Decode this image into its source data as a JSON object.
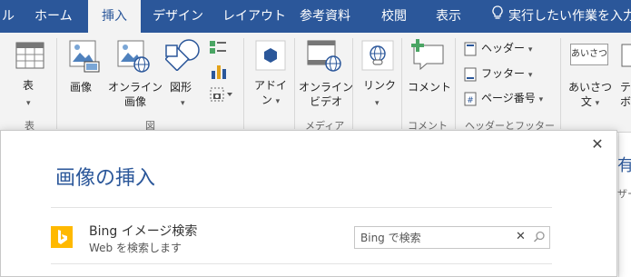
{
  "tabs": [
    {
      "label": "ル",
      "active": false
    },
    {
      "label": "ホーム",
      "active": false
    },
    {
      "label": "挿入",
      "active": true
    },
    {
      "label": "デザイン",
      "active": false
    },
    {
      "label": "レイアウト",
      "active": false
    },
    {
      "label": "参考資料",
      "active": false
    },
    {
      "label": "校閲",
      "active": false
    },
    {
      "label": "表示",
      "active": false
    }
  ],
  "tellme": {
    "label": "実行したい作業を入力"
  },
  "ribbon": {
    "table": {
      "label": "表",
      "group": "表"
    },
    "picture": {
      "label": "画像"
    },
    "online_picture": {
      "line1": "オンライン",
      "line2": "画像"
    },
    "shapes": {
      "label": "図形"
    },
    "illustrations_group": "図",
    "addins": {
      "line1": "アドイ",
      "line2": "ン"
    },
    "online_video": {
      "line1": "オンライン",
      "line2": "ビデオ"
    },
    "media_group": "メディア",
    "link": {
      "label": "リンク"
    },
    "comment": {
      "label": "コメント",
      "group": "コメント"
    },
    "header": {
      "label": "ヘッダー"
    },
    "footer": {
      "label": "フッター"
    },
    "page_number": {
      "label": "ページ番号"
    },
    "header_footer_group": "ヘッダーとフッター",
    "greeting": {
      "badge": "あいさつ",
      "line1": "あいさつ",
      "line2": "文"
    },
    "textbox": {
      "line1": "テ",
      "line2": "ボ"
    }
  },
  "dialog": {
    "title": "画像の挿入",
    "bing": {
      "title": "Bing イメージ検索",
      "subtitle": "Web を検索します",
      "placeholder": "Bing で検索"
    }
  },
  "background_doc": {
    "char1": "有",
    "char2": "ザー"
  },
  "colors": {
    "accent": "#2b579a",
    "ribbon": "#f3f3f3",
    "bing": "#ffb900"
  }
}
